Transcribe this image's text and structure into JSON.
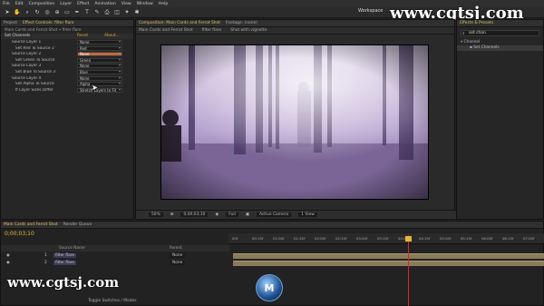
{
  "menu": [
    "File",
    "Edit",
    "Composition",
    "Layer",
    "Effect",
    "Animation",
    "View",
    "Window",
    "Help"
  ],
  "workspace": "Workspace",
  "watermark": "www.cgtsj.com",
  "left_panel": {
    "tabs": [
      "Project",
      "Effect Controls: filter flare"
    ],
    "breadcrumb": "Main Cards and Ferrot Shot • filter flare",
    "effect_name": "Set Channels",
    "reset": "Reset",
    "about": "About...",
    "rows": [
      {
        "label": "Source Layer 1",
        "value": "None"
      },
      {
        "label": "Set Red To Source 1's",
        "value": "Red"
      },
      {
        "label": "Source Layer 2",
        "value": "None"
      },
      {
        "label": "Set Green To Source 2's",
        "value": "Green"
      },
      {
        "label": "Source Layer 3",
        "value": "None"
      },
      {
        "label": "Set Blue To Source 3's",
        "value": "Blue"
      },
      {
        "label": "Source Layer 4",
        "value": "None"
      },
      {
        "label": "Set Alpha To Source 4's",
        "value": "Alpha"
      },
      {
        "label": "If Layer Sizes Differ",
        "value": "Stretch Layers to Fit"
      }
    ]
  },
  "viewer": {
    "tabs": [
      "Composition: Main Cards and Ferrot Shot",
      "Footage: (none)"
    ],
    "breadcrumbs": [
      "Main Cards and Ferrot Shot",
      "filter flare",
      "Shot with vignette"
    ],
    "zoom": "50%",
    "timecode": "0;00;03;10",
    "resolution": "Full",
    "camera": "Active Camera",
    "views": "1 View"
  },
  "right_panel": {
    "tab": "Effects & Presets",
    "search": "set chan",
    "category": "Channel",
    "result": "Set Channels"
  },
  "timeline": {
    "tabs": [
      "Main Cards and Ferrot Shot",
      "Render Queue"
    ],
    "current_time": "0;00;03;10",
    "header_source": "Source Name",
    "header_parent": "Parent",
    "layers": [
      {
        "num": "1",
        "name": "filter flare",
        "parent": "None"
      },
      {
        "num": "2",
        "name": "filter flare",
        "parent": "None"
      }
    ],
    "ruler": [
      "00f",
      "00:15f",
      "01:00f",
      "01:15f",
      "02:00f",
      "02:15f",
      "03:00f",
      "03:15f",
      "04:00f",
      "04:15f",
      "05:00f",
      "05:15f",
      "06:00f",
      "06:15f",
      "07:00f"
    ],
    "toggle": "Toggle Switches / Modes"
  }
}
